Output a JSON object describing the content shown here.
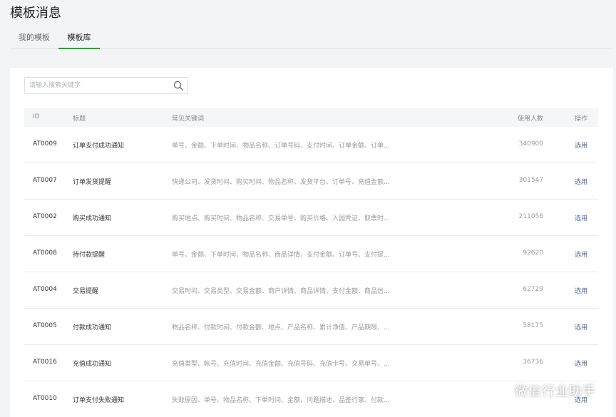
{
  "page": {
    "title": "模板消息"
  },
  "tabs": [
    {
      "label": "我的模板",
      "active": false
    },
    {
      "label": "模板库",
      "active": true
    }
  ],
  "search": {
    "placeholder": "请输入搜索关键字",
    "value": ""
  },
  "table": {
    "headers": {
      "id": "ID",
      "title": "标题",
      "keywords": "常见关键词",
      "users": "使用人数",
      "op": "操作"
    },
    "rows": [
      {
        "id": "AT0009",
        "title": "订单支付成功通知",
        "keywords": "单号、金额、下单时间、物品名称、订单号码、支付时间、订单金额、订单…",
        "users": "340900",
        "op": "选用"
      },
      {
        "id": "AT0007",
        "title": "订单发货提醒",
        "keywords": "快递公司、发货时间、购买时间、物品名称、发货平台、订单号、充值金额…",
        "users": "301547",
        "op": "选用"
      },
      {
        "id": "AT0002",
        "title": "购买成功通知",
        "keywords": "购买地点、购买时间、物品名称、交易单号、购买价格、入园凭证、取票时…",
        "users": "211056",
        "op": "选用"
      },
      {
        "id": "AT0008",
        "title": "待付款提醒",
        "keywords": "单号、金额、下单时间、物品名称、商品详情、支付金额、订单号、支付提…",
        "users": "92620",
        "op": "选用"
      },
      {
        "id": "AT0004",
        "title": "交易提醒",
        "keywords": "交易时间、交易类型、交易金额、商户详情、商品详情、支付金额、商品信…",
        "users": "62729",
        "op": "选用"
      },
      {
        "id": "AT0005",
        "title": "付款成功通知",
        "keywords": "物品名称、付款时间、付款金额、地点、产品名称、累计净值、产品期限、…",
        "users": "58175",
        "op": "选用"
      },
      {
        "id": "AT0016",
        "title": "充值成功通知",
        "keywords": "充值类型、帐号、充值时间、充值金额、充值号码、充值卡号、交易单号、…",
        "users": "36736",
        "op": "选用"
      },
      {
        "id": "AT0010",
        "title": "订单支付失败通知",
        "keywords": "失败原因、单号、物品名称、下单时间、金额、问题描述、品鉴行家、付款…",
        "users": "",
        "op": "选用"
      }
    ]
  },
  "watermark": {
    "text": "微信行业助手",
    "icon": "wechat-icon"
  },
  "colors": {
    "accent": "#1aad19",
    "link": "#576b95"
  }
}
